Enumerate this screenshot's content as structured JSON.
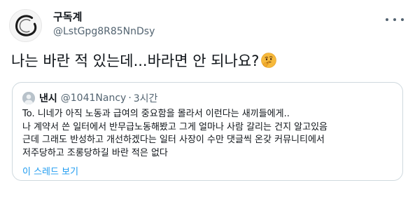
{
  "author": {
    "display_name": "구독계",
    "handle": "@LstGpg8R85NnDsy"
  },
  "tweet": {
    "text": "나는 바란 적 있는데...바라면 안 되나요?",
    "emoji": "thinking-face-icon"
  },
  "quote": {
    "display_name": "낸시",
    "handle": "@1041Nancy",
    "separator": "·",
    "time": "3시간",
    "lines": [
      "To. 니네가 아직 노동과 급여의 중요함을 몰라서 이런다는 새끼들에게..",
      "나 계약서 쓴 일터에서 반무급노동해봤고 그게 얼마나 사람 갈리는 건지 알고있음",
      "근데 그래도 반성하고 개선하겠다는 일터 사장이 수만 댓글씩 온갖 커뮤니티에서",
      "저주당하고 조롱당하길 바란 적은 없다"
    ],
    "thread_link": "이 스레드 보기"
  },
  "colors": {
    "text": "#0f1419",
    "secondary": "#536471",
    "link": "#1d9bf0",
    "border": "#cfd9de"
  }
}
